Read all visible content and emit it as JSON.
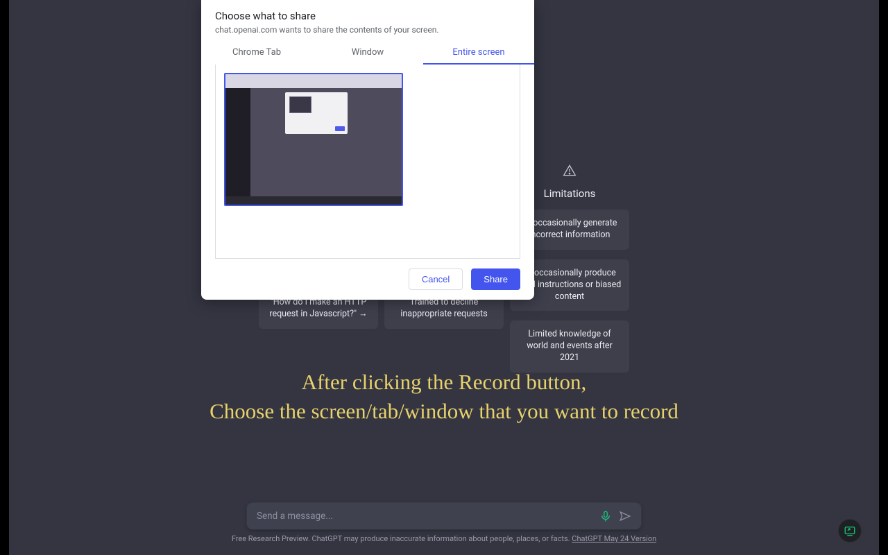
{
  "dialog": {
    "title": "Choose what to share",
    "subtitle": "chat.openai.com wants to share the contents of your screen.",
    "tabs": {
      "chrome": "Chrome Tab",
      "window": "Window",
      "entire": "Entire screen"
    },
    "cancel": "Cancel",
    "share": "Share"
  },
  "columns": {
    "limitations": {
      "title": "Limitations",
      "cards": [
        "ay occasionally generate incorrect information",
        "ay occasionally produce mful instructions or biased content",
        "Limited knowledge of world and events after 2021"
      ]
    },
    "capabilities": {
      "cards": [
        "Trained to decline inappropriate requests"
      ]
    },
    "examples": {
      "cards": [
        "\"How do I make an HTTP request in Javascript?\" →"
      ]
    }
  },
  "instruction": {
    "line1": "After clicking the Record button,",
    "line2": "Choose the screen/tab/window that you want to record"
  },
  "input": {
    "placeholder": "Send a message..."
  },
  "footer": {
    "text": "Free Research Preview. ChatGPT may produce inaccurate information about people, places, or facts. ",
    "link": "ChatGPT May 24 Version"
  }
}
